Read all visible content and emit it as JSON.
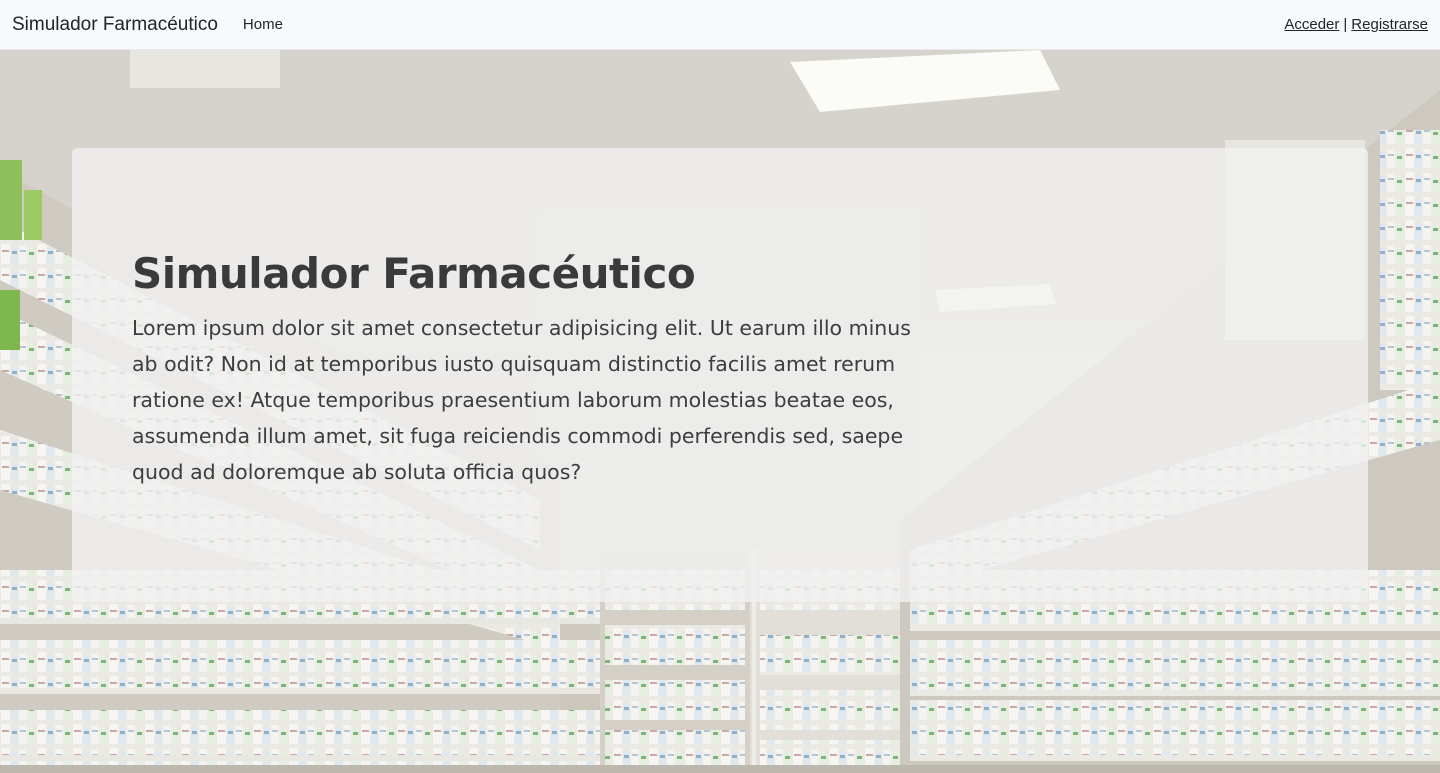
{
  "navbar": {
    "brand": "Simulador Farmacéutico",
    "links": [
      {
        "label": "Home"
      }
    ],
    "auth": {
      "login_label": "Acceder",
      "separator": "|",
      "register_label": "Registrarse"
    }
  },
  "hero": {
    "title": "Simulador Farmacéutico",
    "description": "Lorem ipsum dolor sit amet consectetur adipisicing elit. Ut earum illo minus ab odit? Non id at temporibus iusto quisquam distinctio facilis amet rerum ratione ex! Atque temporibus praesentium laborum molestias beatae eos, assumenda illum amet, sit fuga reiciendis commodi perferendis sed, saepe quod ad doloremque ab soluta officia quos?",
    "background": "pharmacy-shelves-photo"
  },
  "colors": {
    "navbar_bg": "#f8f9fa",
    "text": "#212529",
    "card_bg": "rgba(240,240,240,0.82)"
  }
}
